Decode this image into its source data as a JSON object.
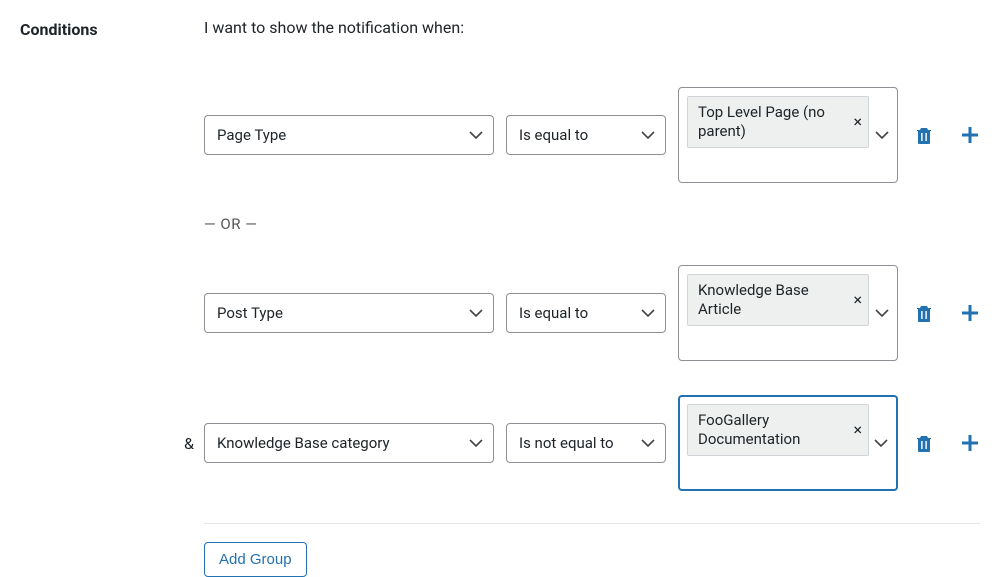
{
  "section_label": "Conditions",
  "intro_text": "I want to show the notification when:",
  "or_separator": "— OR —",
  "and_prefix": "&",
  "add_group_label": "Add Group",
  "rules": {
    "r0": {
      "field": "Page Type",
      "operator": "Is equal to",
      "chip_text": "Top Level Page (no parent)"
    },
    "r1": {
      "field": "Post Type",
      "operator": "Is equal to",
      "chip_text": "Knowledge Base Article"
    },
    "r2": {
      "field": "Knowledge Base category",
      "operator": "Is not equal to",
      "chip_text": "FooGallery Documentation"
    }
  }
}
